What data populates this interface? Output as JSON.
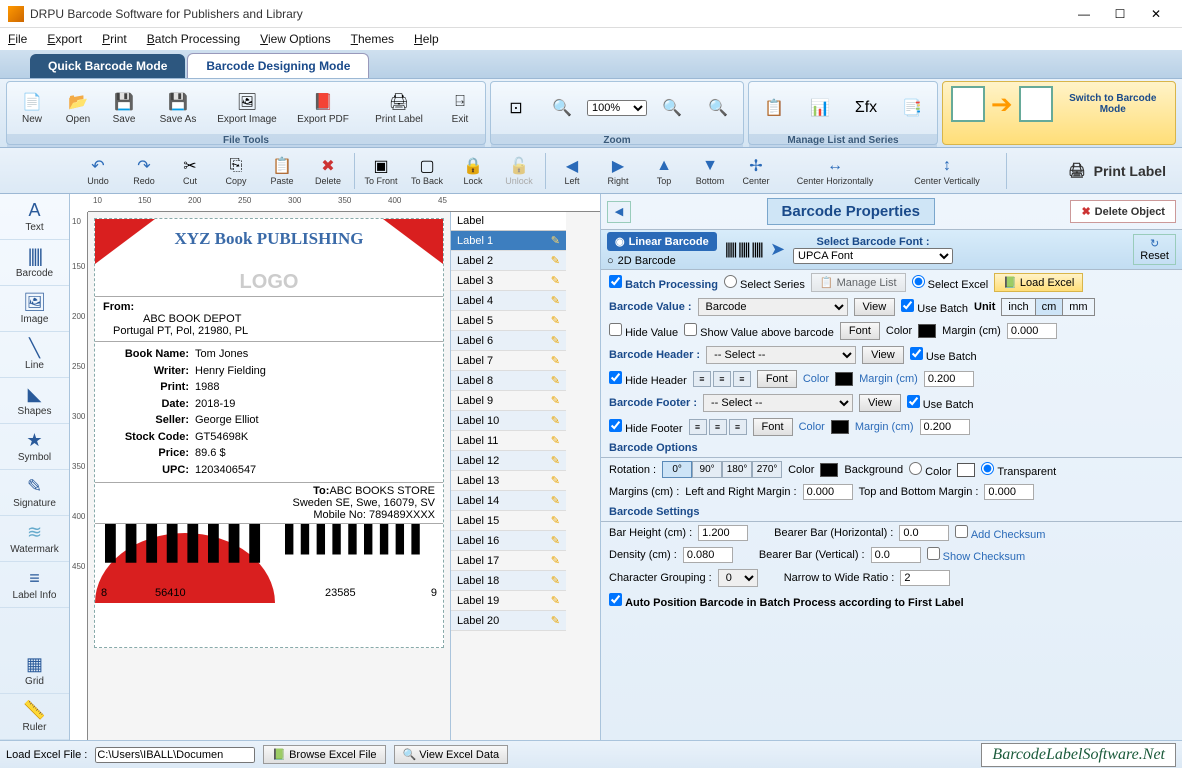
{
  "titlebar": {
    "title": "DRPU Barcode Software for Publishers and Library"
  },
  "menu": [
    "File",
    "Export",
    "Print",
    "Batch Processing",
    "View Options",
    "Themes",
    "Help"
  ],
  "tabs": {
    "quick": "Quick Barcode Mode",
    "design": "Barcode Designing Mode"
  },
  "ribbon": {
    "file_tools_label": "File Tools",
    "new": "New",
    "open": "Open",
    "save": "Save",
    "saveas": "Save As",
    "export_img": "Export Image",
    "export_pdf": "Export PDF",
    "print_label": "Print Label",
    "exit": "Exit",
    "zoom_label": "Zoom",
    "zoom_pct": "100%",
    "list_label": "Manage List and Series",
    "switch": "Switch to\nBarcode\nMode"
  },
  "tb2": {
    "undo": "Undo",
    "redo": "Redo",
    "cut": "Cut",
    "copy": "Copy",
    "paste": "Paste",
    "delete": "Delete",
    "tofront": "To Front",
    "toback": "To Back",
    "lock": "Lock",
    "unlock": "Unlock",
    "left": "Left",
    "right": "Right",
    "top": "Top",
    "bottom": "Bottom",
    "center": "Center",
    "centerh": "Center Horizontally",
    "centerv": "Center Vertically",
    "print": "Print Label"
  },
  "side_tools": [
    "Text",
    "Barcode",
    "Image",
    "Line",
    "Shapes",
    "Symbol",
    "Signature",
    "Watermark",
    "Label Info",
    "Grid",
    "Ruler"
  ],
  "ruler_h_marks": [
    "10",
    "150",
    "200",
    "250",
    "300",
    "350",
    "400",
    "45"
  ],
  "ruler_v_marks": [
    "10",
    "150",
    "200",
    "250",
    "300",
    "350",
    "400",
    "450"
  ],
  "label_preview": {
    "heading": "XYZ Book PUBLISHING",
    "logo": "LOGO",
    "from_label": "From:",
    "from_1": "ABC BOOK DEPOT",
    "from_2": "Portugal PT, Pol, 21980, PL",
    "rows": [
      {
        "k": "Book Name:",
        "v": "Tom Jones"
      },
      {
        "k": "Writer:",
        "v": "Henry Fielding"
      },
      {
        "k": "Print:",
        "v": "1988"
      },
      {
        "k": "Date:",
        "v": "2018-19"
      },
      {
        "k": "Seller:",
        "v": "George Elliot"
      },
      {
        "k": "Stock Code:",
        "v": "GT54698K"
      },
      {
        "k": "Price:",
        "v": "89.6 $"
      },
      {
        "k": "UPC:",
        "v": "1203406547"
      }
    ],
    "to_label": "To:",
    "to_1": "ABC BOOKS STORE",
    "to_2": "Sweden SE, Swe, 16079, SV",
    "mobile": "Mobile No: 789489XXXX",
    "bc_left": "8",
    "bc_left2": "56410",
    "bc_right": "23585",
    "bc_right2": "9"
  },
  "label_list_header": "Label",
  "label_list": [
    "Label 1",
    "Label 2",
    "Label 3",
    "Label 4",
    "Label 5",
    "Label 6",
    "Label 7",
    "Label 8",
    "Label 9",
    "Label 10",
    "Label 11",
    "Label 12",
    "Label 13",
    "Label 14",
    "Label 15",
    "Label 16",
    "Label 17",
    "Label 18",
    "Label 19",
    "Label 20"
  ],
  "label_list_selected": 0,
  "props": {
    "title": "Barcode Properties",
    "delete": "Delete Object",
    "linear": "Linear Barcode",
    "twod": "2D Barcode",
    "font_label": "Select Barcode Font :",
    "font_value": "UPCA Font",
    "reset": "Reset",
    "batch": "Batch Processing",
    "select_series": "Select Series",
    "manage_list": "Manage List",
    "select_excel": "Select Excel",
    "load_excel": "Load Excel",
    "value_lbl": "Barcode Value :",
    "value": "Barcode",
    "view": "View",
    "use_batch": "Use Batch",
    "unit": "Unit",
    "inch": "inch",
    "cm": "cm",
    "mm": "mm",
    "hide_value": "Hide Value",
    "show_above": "Show Value above barcode",
    "font_btn": "Font",
    "color": "Color",
    "margin_cm": "Margin (cm)",
    "margin_v": "0.000",
    "header_lbl": "Barcode Header :",
    "select_placeholder": "-- Select --",
    "hide_header": "Hide Header",
    "hdr_margin": "0.200",
    "footer_lbl": "Barcode Footer :",
    "hide_footer": "Hide Footer",
    "ftr_margin": "0.200",
    "options": "Barcode Options",
    "rotation": "Rotation :",
    "r0": "0°",
    "r90": "90°",
    "r180": "180°",
    "r270": "270°",
    "background": "Background",
    "transparent": "Transparent",
    "margins_lbl": "Margins (cm) :",
    "lr_margin": "Left and Right Margin :",
    "lr_v": "0.000",
    "tb_margin": "Top and Bottom Margin :",
    "tb_v": "0.000",
    "settings": "Barcode Settings",
    "barh": "Bar Height (cm) :",
    "barh_v": "1.200",
    "bbh": "Bearer Bar (Horizontal) :",
    "bbh_v": "0.0",
    "addck": "Add Checksum",
    "density": "Density (cm) :",
    "density_v": "0.080",
    "bbv": "Bearer Bar (Vertical) :",
    "bbv_v": "0.0",
    "showck": "Show Checksum",
    "chargroup": "Character Grouping :",
    "chargroup_v": "0",
    "nwr": "Narrow to Wide Ratio :",
    "nwr_v": "2",
    "autopos": "Auto Position Barcode in Batch Process according to First Label"
  },
  "bottom": {
    "load_lbl": "Load Excel File :",
    "path": "C:\\Users\\IBALL\\Documen",
    "browse": "Browse Excel File",
    "viewdata": "View Excel Data",
    "brand": "BarcodeLabelSoftware.Net"
  }
}
